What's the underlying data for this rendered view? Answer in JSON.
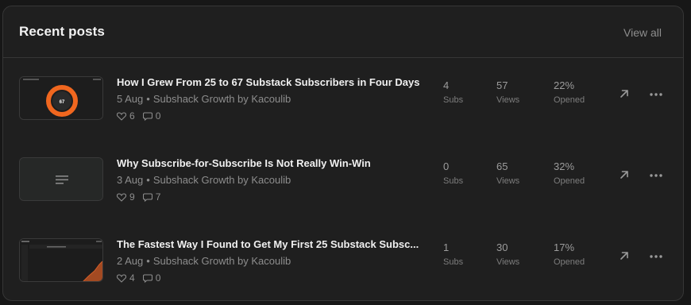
{
  "header": {
    "title": "Recent posts",
    "view_all": "View all"
  },
  "posts": [
    {
      "title": "How I Grew From 25 to 67 Substack Subscribers in Four Days",
      "date": "5 Aug",
      "publication": "Subshack Growth by Kacoulib",
      "likes": "6",
      "comments": "0",
      "subs": "4",
      "subs_label": "Subs",
      "views": "57",
      "views_label": "Views",
      "opened": "22%",
      "opened_label": "Opened",
      "thumb_text": "67"
    },
    {
      "title": "Why Subscribe-for-Subscribe Is Not Really Win-Win",
      "date": "3 Aug",
      "publication": "Subshack Growth by Kacoulib",
      "likes": "9",
      "comments": "7",
      "subs": "0",
      "subs_label": "Subs",
      "views": "65",
      "views_label": "Views",
      "opened": "32%",
      "opened_label": "Opened"
    },
    {
      "title": "The Fastest Way I Found to Get My First 25 Substack Subsc...",
      "date": "2 Aug",
      "publication": "Subshack Growth by Kacoulib",
      "likes": "4",
      "comments": "0",
      "subs": "1",
      "subs_label": "Subs",
      "views": "30",
      "views_label": "Views",
      "opened": "17%",
      "opened_label": "Opened"
    }
  ],
  "icons": {
    "like": "heart-icon",
    "comment": "comment-icon",
    "open": "arrow-up-right-icon",
    "more": "more-horizontal-icon"
  },
  "colors": {
    "background": "#1f1f1f",
    "border": "#363636",
    "accent_orange": "#f0671f"
  }
}
